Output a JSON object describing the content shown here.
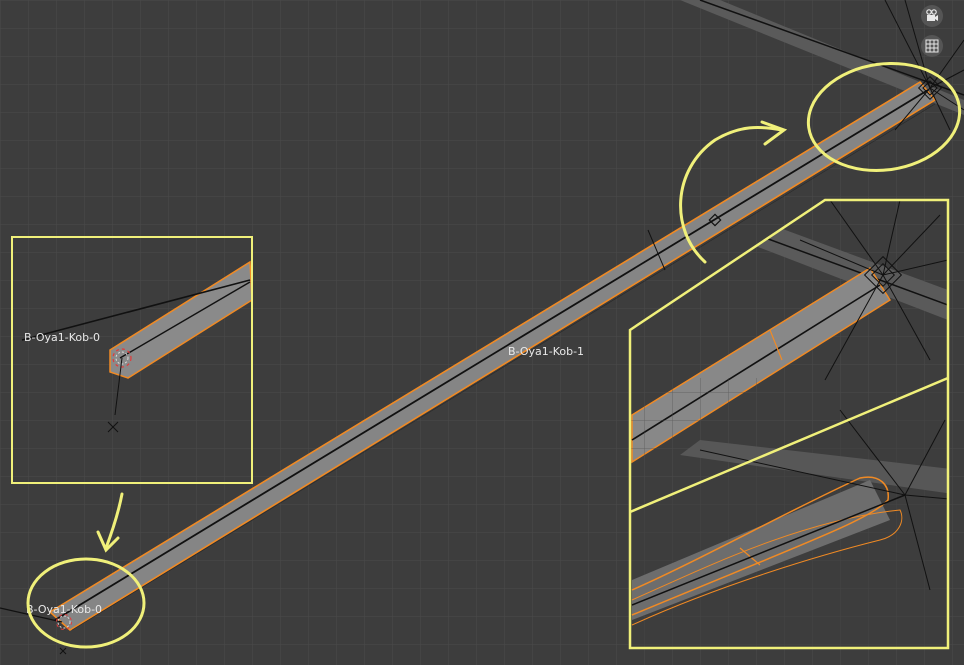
{
  "viewport": {
    "labels": {
      "bone_main": "B-Oya1-Kob-1",
      "bone_root_inset": "B-Oya1-Kob-0",
      "bone_root_bottom": "B-Oya1-Kob-0"
    },
    "nav_buttons": {
      "camera_icon": "camera-icon",
      "grid_icon": "grid-icon"
    },
    "colors": {
      "background": "#3d3d3d",
      "grid": "#4a4a4a",
      "bone_fill": "#8a8a8a",
      "bone_outline": "#f08a24",
      "annotation": "#f0f07a"
    }
  }
}
